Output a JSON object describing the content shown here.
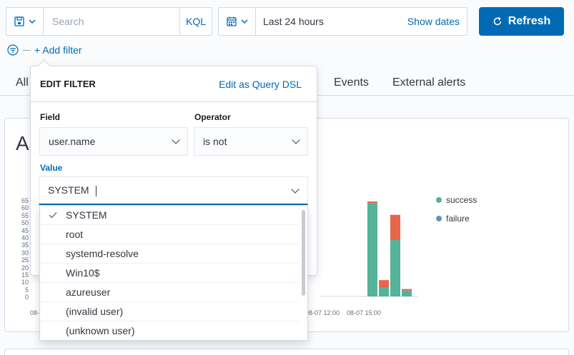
{
  "querybar": {
    "search_placeholder": "Search",
    "language": "KQL"
  },
  "datepicker": {
    "range": "Last 24 hours",
    "show_dates": "Show dates"
  },
  "refresh_label": "Refresh",
  "add_filter": "+ Add filter",
  "tabs": [
    "All",
    "Events",
    "External alerts"
  ],
  "panel": {
    "title_fragment": "A",
    "y_ticks": [
      "65",
      "60",
      "55",
      "50",
      "45",
      "40",
      "35",
      "30",
      "25",
      "20",
      "15",
      "10",
      "5",
      "0"
    ],
    "x_ticks": [
      "08-",
      "08-07 12:00",
      "08-07 15:00"
    ],
    "legend": [
      {
        "label": "success",
        "color": "#54b399"
      },
      {
        "label": "failure",
        "color": "#6092c0"
      }
    ],
    "chart_data": {
      "type": "bar",
      "stacked": true,
      "series": [
        {
          "name": "success",
          "color": "#54b399",
          "values": [
            63,
            6,
            38,
            4
          ]
        },
        {
          "name": "failure",
          "color": "#e7664c",
          "values": [
            1,
            5,
            17,
            1
          ]
        }
      ],
      "ylim": [
        0,
        65
      ]
    }
  },
  "filter_editor": {
    "title": "EDIT FILTER",
    "edit_dsl": "Edit as Query DSL",
    "field_label": "Field",
    "field_value": "user.name",
    "operator_label": "Operator",
    "operator_value": "is not",
    "value_label": "Value",
    "value_input": "SYSTEM",
    "options": [
      {
        "label": "SYSTEM",
        "selected": true
      },
      {
        "label": "root",
        "selected": false
      },
      {
        "label": "systemd-resolve",
        "selected": false
      },
      {
        "label": "Win10$",
        "selected": false
      },
      {
        "label": "azureuser",
        "selected": false
      },
      {
        "label": "(invalid user)",
        "selected": false
      },
      {
        "label": "(unknown user)",
        "selected": false
      }
    ]
  },
  "colors": {
    "accent": "#006bb4",
    "success": "#54b399",
    "failure": "#e7664c"
  }
}
